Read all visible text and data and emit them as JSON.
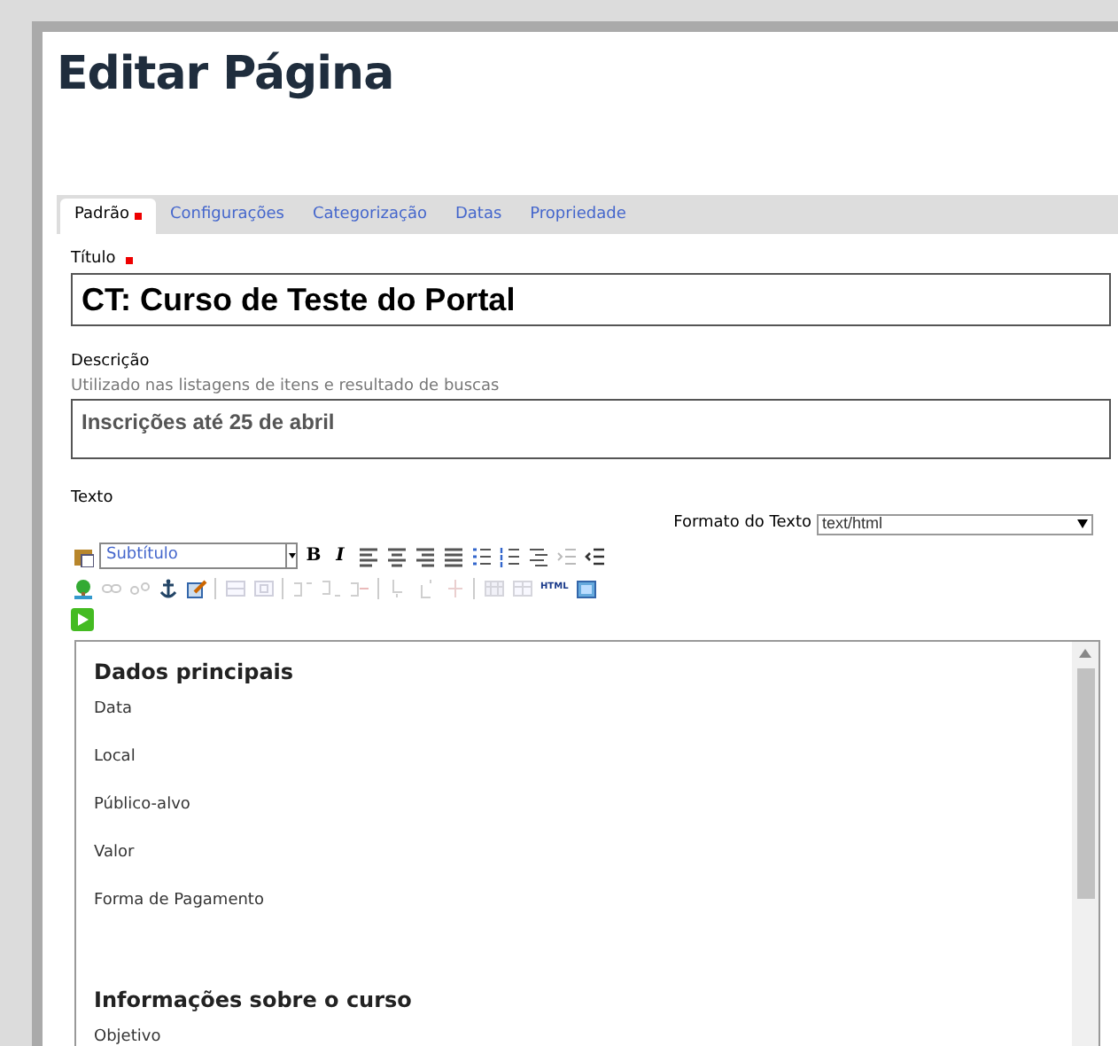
{
  "page_title": "Editar Página",
  "tabs": [
    {
      "label": "Padrão",
      "selected": true,
      "required": true
    },
    {
      "label": "Configurações",
      "selected": false,
      "required": false
    },
    {
      "label": "Categorização",
      "selected": false,
      "required": false
    },
    {
      "label": "Datas",
      "selected": false,
      "required": false
    },
    {
      "label": "Propriedade",
      "selected": false,
      "required": false
    }
  ],
  "title_field": {
    "label": "Título",
    "required": true,
    "value": "CT: Curso de Teste do Portal"
  },
  "description_field": {
    "label": "Descrição",
    "hint": "Utilizado nas listagens de itens e resultado de buscas",
    "value": "Inscrições até 25 de abril"
  },
  "text_field": {
    "label": "Texto",
    "format_label": "Formato do Texto",
    "format_value": "text/html"
  },
  "toolbar": {
    "style_value": "Subtítulo",
    "bold": "B",
    "italic": "I",
    "html": "HTML",
    "row_1": [
      {
        "kind": "paste",
        "disabled": false
      },
      {
        "kind": "style"
      },
      {
        "kind": "bold",
        "disabled": false
      },
      {
        "kind": "italic",
        "disabled": false
      },
      {
        "kind": "align-left",
        "disabled": false
      },
      {
        "kind": "align-center",
        "disabled": false
      },
      {
        "kind": "align-right",
        "disabled": false
      },
      {
        "kind": "justify",
        "disabled": false
      },
      {
        "kind": "bullets",
        "disabled": false
      },
      {
        "kind": "numbers",
        "disabled": false
      },
      {
        "kind": "definition",
        "disabled": false
      },
      {
        "kind": "outdent",
        "disabled": true
      },
      {
        "kind": "indent",
        "disabled": false
      }
    ],
    "row_2": [
      {
        "kind": "image",
        "disabled": false
      },
      {
        "kind": "link",
        "disabled": true
      },
      {
        "kind": "unlink",
        "disabled": true
      },
      {
        "kind": "anchor",
        "disabled": false
      },
      {
        "kind": "edit",
        "disabled": false
      },
      {
        "kind": "separator"
      },
      {
        "kind": "table-row",
        "disabled": true
      },
      {
        "kind": "table-cell",
        "disabled": true
      },
      {
        "kind": "separator"
      },
      {
        "kind": "row-before",
        "disabled": true
      },
      {
        "kind": "row-after",
        "disabled": true
      },
      {
        "kind": "row-delete",
        "disabled": true
      },
      {
        "kind": "separator"
      },
      {
        "kind": "col-before",
        "disabled": true
      },
      {
        "kind": "col-after",
        "disabled": true
      },
      {
        "kind": "col-delete",
        "disabled": true
      },
      {
        "kind": "separator"
      },
      {
        "kind": "table",
        "disabled": true
      },
      {
        "kind": "table-props",
        "disabled": true
      },
      {
        "kind": "html",
        "disabled": false
      },
      {
        "kind": "fullscreen",
        "disabled": false
      }
    ],
    "row_3": [
      {
        "kind": "play",
        "disabled": false
      }
    ]
  },
  "editor_content": [
    {
      "kind": "heading",
      "text": "Dados principais"
    },
    {
      "kind": "paragraph",
      "text": "Data"
    },
    {
      "kind": "paragraph",
      "text": "Local"
    },
    {
      "kind": "paragraph",
      "text": "Público-alvo"
    },
    {
      "kind": "paragraph",
      "text": "Valor"
    },
    {
      "kind": "paragraph",
      "text": "Forma de Pagamento"
    },
    {
      "kind": "spacer"
    },
    {
      "kind": "heading",
      "text": "Informações sobre o curso"
    },
    {
      "kind": "paragraph",
      "text": "Objetivo"
    }
  ]
}
